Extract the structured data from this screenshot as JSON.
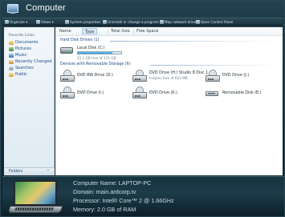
{
  "window": {
    "title": "Computer"
  },
  "toolbar": {
    "buttons": [
      {
        "label": "Organize ▾"
      },
      {
        "label": "Views ▾"
      },
      {
        "label": "System properties"
      },
      {
        "label": "Uninstall or change a program"
      },
      {
        "label": "Map network drive"
      },
      {
        "label": "Open Control Panel"
      }
    ]
  },
  "nav": {
    "heading": "Favorite Links",
    "items": [
      {
        "label": "Documents"
      },
      {
        "label": "Pictures"
      },
      {
        "label": "Music"
      },
      {
        "label": "Recently Changed"
      },
      {
        "label": "Searches"
      },
      {
        "label": "Public"
      }
    ],
    "folders_label": "Folders",
    "folders_chevron": "^"
  },
  "columns": [
    "Name",
    "Type",
    "Total Size",
    "Free Space"
  ],
  "groups": {
    "hdd": {
      "title": "Hard Disk Drives (1)",
      "drives": [
        {
          "name": "Local Disk (C:)",
          "space": "22.1 GB free of 111 GB",
          "used_fraction": 0.8
        }
      ]
    },
    "removable": {
      "title": "Devices with Removable Storage (6)",
      "drives": [
        {
          "name": "DVD RW Drive (D:)",
          "icon_tag": "DVD"
        },
        {
          "name": "DVD Drive (H:) Studio 8 Disc 1",
          "space": "0 bytes free of 623 MB",
          "icon_tag": "DVD"
        },
        {
          "name": "DVD Drive (J:)",
          "icon_tag": "DVD"
        },
        {
          "name": "DVD Drive (I:)",
          "icon_tag": "DVD"
        },
        {
          "name": "DVD Drive (K:)",
          "icon_tag": "DVD"
        },
        {
          "name": "Removable Disk (E:)"
        }
      ]
    }
  },
  "details": {
    "computer_name": "Computer Name: LAPTOP-PC",
    "domain": "Domain: main.ardcorp.tv",
    "processor": "Processor: Intel® Core™ 2 @ 1.66GHz",
    "memory": "Memory: 2.0 GB of RAM"
  },
  "colors": {
    "accent": "#1e4a8c",
    "link": "#1f4d86",
    "frame": "#16313c",
    "progress": "#1f8fd8"
  }
}
